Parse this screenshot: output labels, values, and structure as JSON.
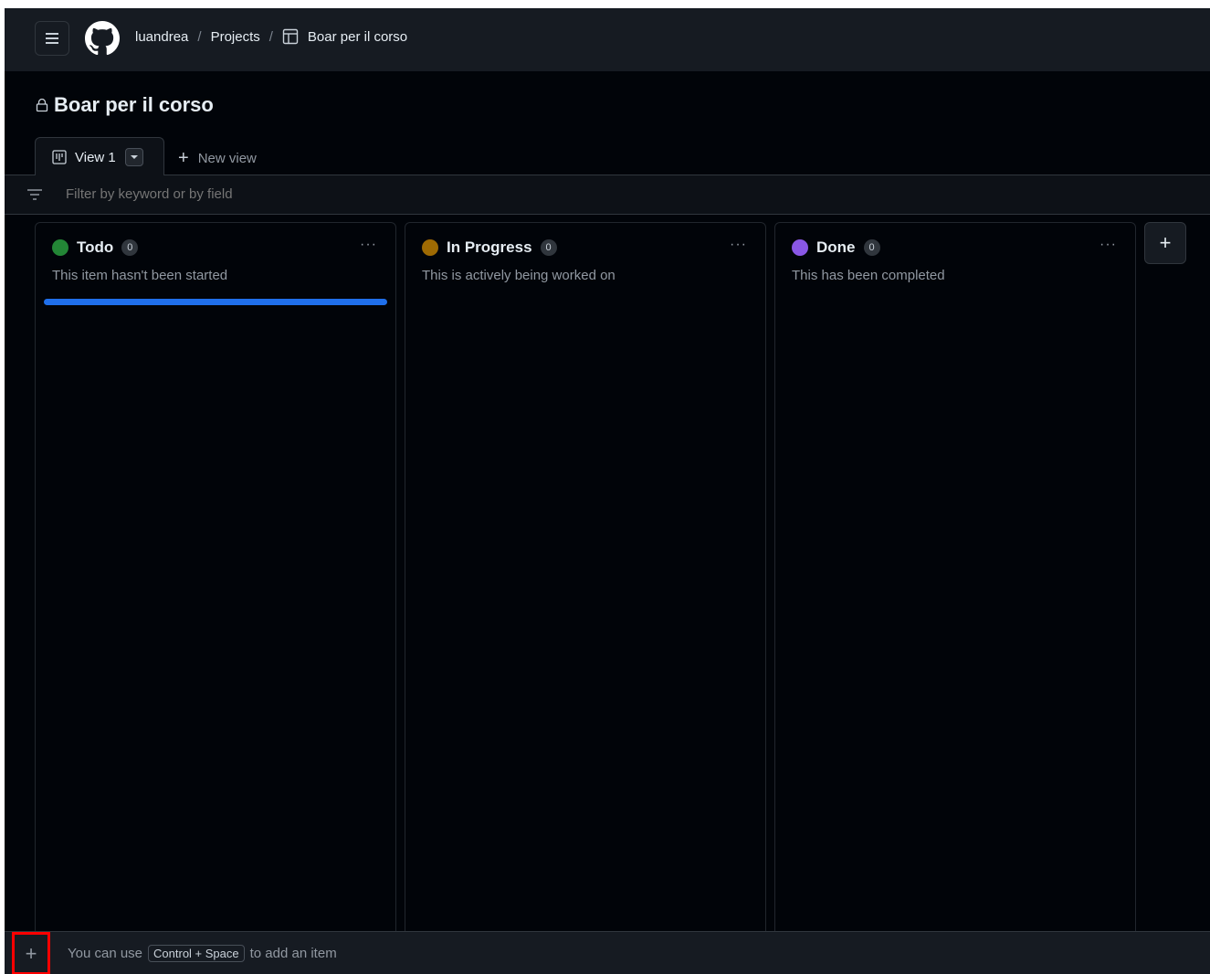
{
  "header": {
    "menu_icon": "hamburger-icon",
    "logo_icon": "github-logo-icon",
    "breadcrumbs": [
      {
        "label": "luandrea"
      },
      {
        "label": "Projects"
      },
      {
        "label": "Boar per il corso",
        "icon": "table-icon"
      }
    ],
    "separator": "/"
  },
  "project": {
    "title": "Boar per il corso",
    "lock_icon": "lock-icon"
  },
  "tabs": {
    "active_label": "View 1",
    "active_icon": "board-view-icon",
    "new_view_label": "New view"
  },
  "filter": {
    "placeholder": "Filter by keyword or by field"
  },
  "columns": [
    {
      "title": "Todo",
      "count": "0",
      "description": "This item hasn't been started",
      "color": "#238636"
    },
    {
      "title": "In Progress",
      "count": "0",
      "description": "This is actively being worked on",
      "color": "#9e6a03"
    },
    {
      "title": "Done",
      "count": "0",
      "description": "This has been completed",
      "color": "#8957e5"
    }
  ],
  "board": {
    "more_label": "···",
    "add_column_label": "+",
    "accent_color": "#1f6feb"
  },
  "footer": {
    "add_label": "+",
    "hint_before": "You can use",
    "hint_shortcut": "Control + Space",
    "hint_after": "to add an item"
  }
}
